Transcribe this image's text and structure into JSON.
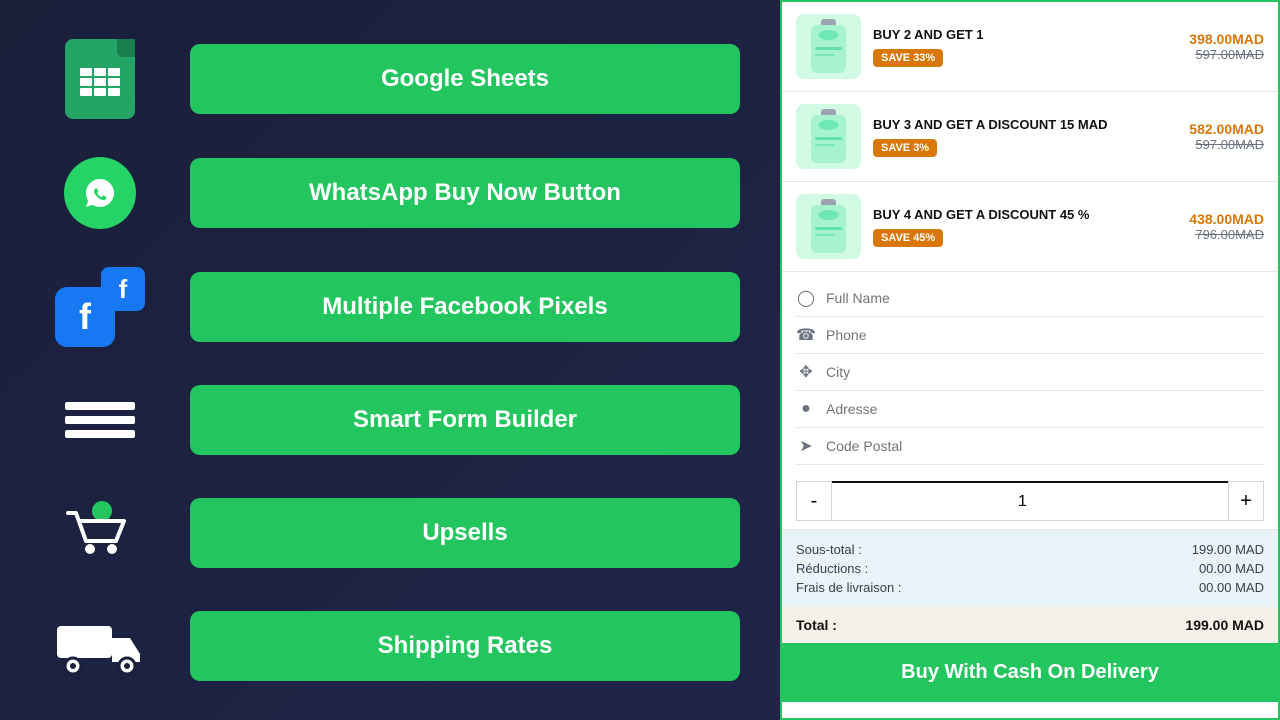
{
  "features": [
    {
      "id": "google-sheets",
      "label": "Google Sheets",
      "icon": "sheets"
    },
    {
      "id": "whatsapp",
      "label": "WhatsApp Buy Now Button",
      "icon": "whatsapp"
    },
    {
      "id": "facebook-pixels",
      "label": "Multiple Facebook Pixels",
      "icon": "facebook"
    },
    {
      "id": "smart-form",
      "label": "Smart Form Builder",
      "icon": "form"
    },
    {
      "id": "upsells",
      "label": "Upsells",
      "icon": "upsells"
    },
    {
      "id": "shipping",
      "label": "Shipping Rates",
      "icon": "truck"
    }
  ],
  "offers": [
    {
      "title": "BUY 2 AND GET 1",
      "badge": "SAVE 33%",
      "price_main": "398.00MAD",
      "price_old": "597.00MAD"
    },
    {
      "title": "BUY 3 AND GET A DISCOUNT 15 MAD",
      "badge": "SAVE 3%",
      "price_main": "582.00MAD",
      "price_old": "597.00MAD"
    },
    {
      "title": "BUY 4 AND GET A DISCOUNT 45 %",
      "badge": "SAVE 45%",
      "price_main": "438.00MAD",
      "price_old": "796.00MAD"
    }
  ],
  "form": {
    "full_name_placeholder": "Full Name",
    "phone_placeholder": "Phone",
    "city_placeholder": "City",
    "address_placeholder": "Adresse",
    "postal_placeholder": "Code Postal"
  },
  "quantity": {
    "value": 1,
    "minus_label": "-",
    "plus_label": "+"
  },
  "totals": {
    "sous_total_label": "Sous-total :",
    "sous_total_value": "199.00 MAD",
    "reductions_label": "Réductions :",
    "reductions_value": "00.00 MAD",
    "frais_label": "Frais de livraison :",
    "frais_value": "00.00 MAD",
    "total_label": "Total :",
    "total_value": "199.00 MAD"
  },
  "buy_button_label": "Buy With Cash On Delivery"
}
